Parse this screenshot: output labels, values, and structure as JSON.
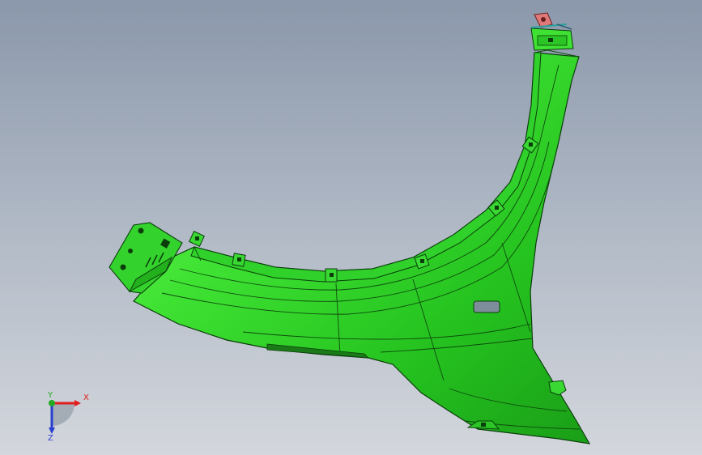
{
  "viewport": {
    "background_top": "#8b98ab",
    "background_bottom": "#d3d6dc",
    "part_color": "#22cc22",
    "part_highlight": "#66ff55",
    "edge_color": "#0b3d0b"
  },
  "triad": {
    "x_label": "X",
    "y_label": "Y",
    "z_label": "Z",
    "x_color": "#e01e1e",
    "y_color": "#22aa22",
    "z_color": "#2a3fd0"
  }
}
